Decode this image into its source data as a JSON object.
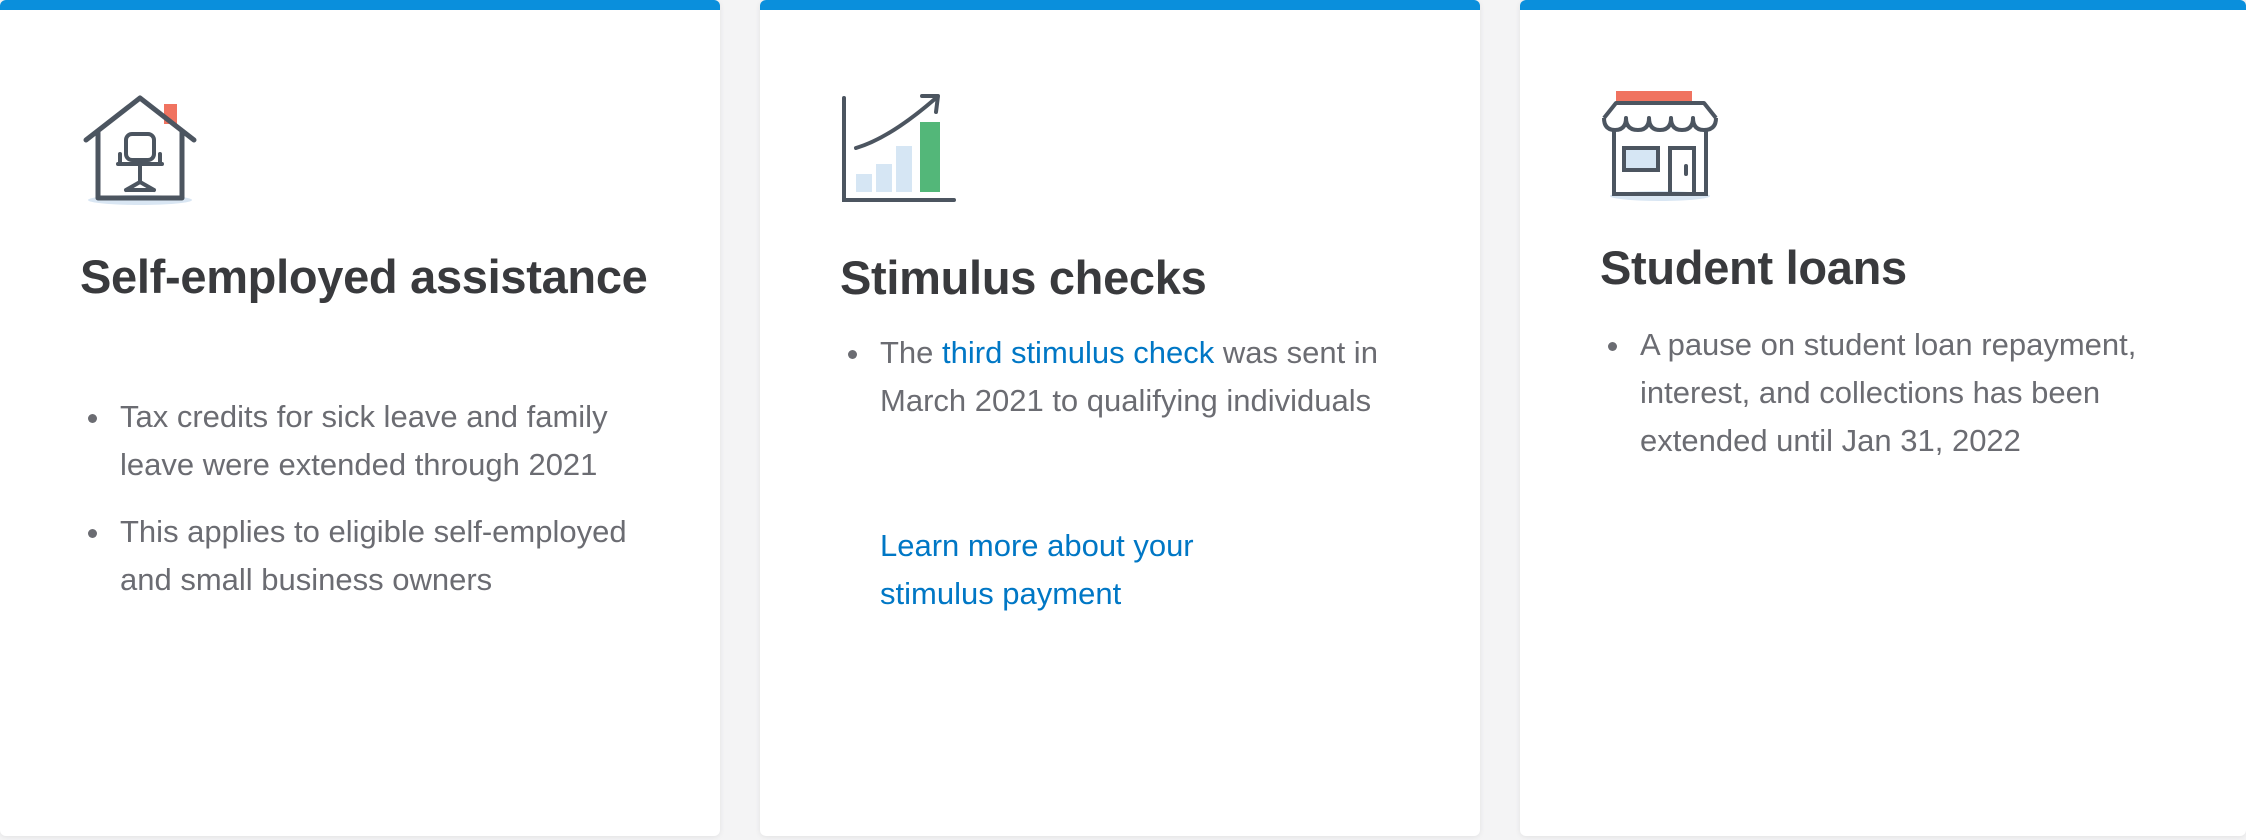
{
  "cards": [
    {
      "icon": "home-office-chair-icon",
      "title": "Self-employed assistance",
      "bullets": [
        "Tax credits for sick leave and family leave were extended through 2021",
        "This applies to eligible self-employed and small business owners"
      ]
    },
    {
      "icon": "growth-bar-chart-icon",
      "title": "Stimulus checks",
      "bullet": {
        "prefix": "The ",
        "link": "third stimulus check",
        "suffix": " was sent in March 2021 to qualifying individuals"
      },
      "learn_more": "Learn more about your stimulus payment"
    },
    {
      "icon": "storefront-icon",
      "title": "Student loans",
      "bullets": [
        "A pause on student loan repayment, interest, and collections has been extended until Jan 31, 2022"
      ]
    }
  ],
  "colors": {
    "accent_bar": "#0a8fdc",
    "link": "#0077c5",
    "title_text": "#393a3d",
    "body_text": "#6b6c72",
    "icon_green": "#53b700",
    "icon_red": "#f07360"
  }
}
